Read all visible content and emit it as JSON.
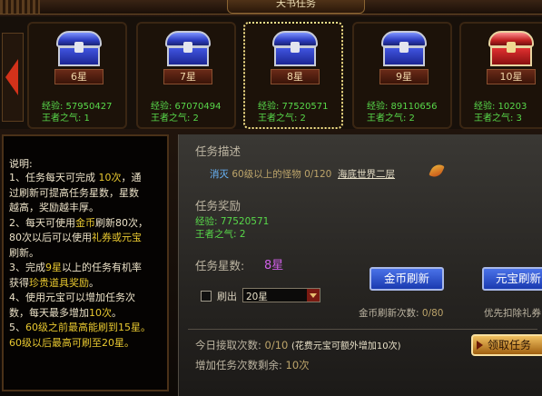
{
  "window": {
    "title": "天书任务"
  },
  "carousel": {
    "cards": [
      {
        "stars": "6星",
        "exp": "经验: 57950427",
        "aura": "王者之气: 1",
        "chest": "blue",
        "selected": false
      },
      {
        "stars": "7星",
        "exp": "经验: 67070494",
        "aura": "王者之气: 2",
        "chest": "blue",
        "selected": false
      },
      {
        "stars": "8星",
        "exp": "经验: 77520571",
        "aura": "王者之气: 2",
        "chest": "blue",
        "selected": true
      },
      {
        "stars": "9星",
        "exp": "经验: 89110656",
        "aura": "王者之气: 2",
        "chest": "blue",
        "selected": false
      },
      {
        "stars": "10星",
        "exp": "经验: 10203",
        "aura": "王者之气: 3",
        "chest": "red",
        "selected": false
      }
    ]
  },
  "instructions": {
    "title": "说明:",
    "lines": [
      [
        {
          "t": "1、任务每天可完成 "
        },
        {
          "t": "10次",
          "h": true
        },
        {
          "t": "，通"
        }
      ],
      [
        {
          "t": "过刷新可提高任务星数，星数"
        }
      ],
      [
        {
          "t": "越高，奖励越丰厚。"
        }
      ],
      [
        {
          "t": "2、每天可使用"
        },
        {
          "t": "金币",
          "h": true
        },
        {
          "t": "刷新80次，"
        }
      ],
      [
        {
          "t": "80次以后可以使用"
        },
        {
          "t": "礼券或元宝",
          "h": true
        }
      ],
      [
        {
          "t": "刷新。"
        }
      ],
      [
        {
          "t": "3、完成"
        },
        {
          "t": "9星",
          "h": true
        },
        {
          "t": "以上的任务有机率"
        }
      ],
      [
        {
          "t": "获得"
        },
        {
          "t": "珍贵道具奖励",
          "h": true
        },
        {
          "t": "。"
        }
      ],
      [
        {
          "t": "4、使用元宝可以增加任务次"
        }
      ],
      [
        {
          "t": "数，每天最多增加"
        },
        {
          "t": "10次",
          "h": true
        },
        {
          "t": "。"
        }
      ],
      [
        {
          "t": "5、"
        },
        {
          "t": "60级之前最高能刷到15星。",
          "h": true
        }
      ],
      [
        {
          "t": "60级以后最高可刷至20星。",
          "h": true
        }
      ]
    ]
  },
  "task": {
    "description_label": "任务描述",
    "kill_text": "消灭",
    "target_text": "60级以上的怪物",
    "progress": "0/120",
    "location": "海底世界二层",
    "reward_label": "任务奖励",
    "reward_exp": "经验: 77520571",
    "reward_aura": "王者之气: 2",
    "star_label": "任务星数:",
    "star_value": "8星",
    "gold_refresh_button": "金币刷新",
    "yuanbao_refresh_button": "元宝刷新",
    "refresh_to_label": "刷出",
    "refresh_to_selected": "20星",
    "gold_refresh_count_label": "金币刷新次数:",
    "gold_refresh_count": "0/80",
    "priority_text": "优先扣除礼券",
    "today_label": "今日接取次数:",
    "today_value": "0/10",
    "today_note": "(花费元宝可额外增加10次)",
    "accept_button": "领取任务",
    "remaining_label": "增加任务次数剩余:",
    "remaining_value": "10次"
  },
  "colors": {
    "exp_green": "#58d84a",
    "highlight_yellow": "#e8c830",
    "star_purple": "#d060e8",
    "button_blue": "#2a50d0"
  },
  "icons": [
    "chevron-left-icon",
    "treasure-chest-icon",
    "feather-icon",
    "dropdown-arrow-icon",
    "play-arrow-icon"
  ]
}
